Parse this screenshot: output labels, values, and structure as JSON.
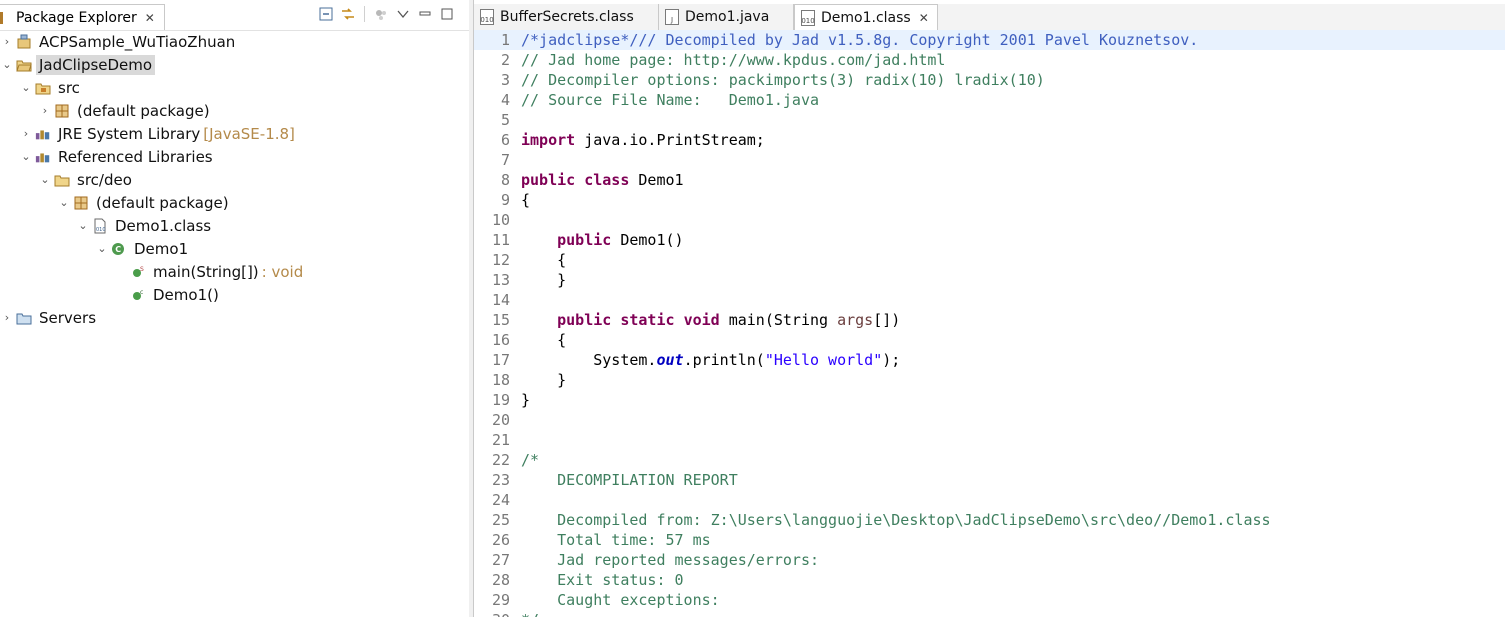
{
  "package_explorer": {
    "title": "Package Explorer",
    "close": "✕",
    "tree": [
      {
        "label": "ACPSample_WuTiaoZhuan",
        "decoration": "",
        "indent": 0,
        "arrow": "›",
        "icon": "project-icon"
      },
      {
        "label": "JadClipseDemo",
        "decoration": "",
        "indent": 0,
        "arrow": "⌄",
        "icon": "project-open-icon",
        "selected": true
      },
      {
        "label": "src",
        "decoration": "",
        "indent": 1,
        "arrow": "⌄",
        "icon": "source-folder-icon"
      },
      {
        "label": "(default package)",
        "decoration": "",
        "indent": 2,
        "arrow": "›",
        "icon": "package-icon"
      },
      {
        "label": "JRE System Library",
        "decoration": "[JavaSE-1.8]",
        "indent": 1,
        "arrow": "›",
        "icon": "library-icon"
      },
      {
        "label": "Referenced Libraries",
        "decoration": "",
        "indent": 1,
        "arrow": "⌄",
        "icon": "library-icon"
      },
      {
        "label": "src/deo",
        "decoration": "",
        "indent": 2,
        "arrow": "⌄",
        "icon": "folder-icon"
      },
      {
        "label": "(default package)",
        "decoration": "",
        "indent": 3,
        "arrow": "⌄",
        "icon": "package-icon"
      },
      {
        "label": "Demo1.class",
        "decoration": "",
        "indent": 4,
        "arrow": "⌄",
        "icon": "class-file-icon"
      },
      {
        "label": "Demo1",
        "decoration": "",
        "indent": 5,
        "arrow": "⌄",
        "icon": "class-icon"
      },
      {
        "label": "main(String[])",
        "decoration": ": void",
        "indent": 6,
        "arrow": "",
        "icon": "method-static-icon"
      },
      {
        "label": "Demo1()",
        "decoration": "",
        "indent": 6,
        "arrow": "",
        "icon": "constructor-icon"
      },
      {
        "label": "Servers",
        "decoration": "",
        "indent": 0,
        "arrow": "›",
        "icon": "servers-folder-icon"
      }
    ]
  },
  "editor": {
    "tabs": [
      {
        "label": "BufferSecrets.class",
        "active": false
      },
      {
        "label": "Demo1.java",
        "active": false
      },
      {
        "label": "Demo1.class",
        "active": true
      }
    ],
    "close": "✕",
    "lines": [
      [
        {
          "t": "/*jadclipse*/// Decompiled by Jad v1.5.8g. Copyright 2001 Pavel Kouznetsov.",
          "c": "jd"
        }
      ],
      [
        {
          "t": "// Jad home page: http://www.kpdus.com/jad.html",
          "c": "c"
        }
      ],
      [
        {
          "t": "// Decompiler options: packimports(3) radix(10) lradix(10) ",
          "c": "c"
        }
      ],
      [
        {
          "t": "// Source File Name:   Demo1.java",
          "c": "c"
        }
      ],
      [],
      [
        {
          "t": "import",
          "c": "kw"
        },
        {
          "t": " java.io.PrintStream;",
          "c": "txt"
        }
      ],
      [],
      [
        {
          "t": "public",
          "c": "kw"
        },
        {
          "t": " ",
          "c": "txt"
        },
        {
          "t": "class",
          "c": "kw"
        },
        {
          "t": " Demo1",
          "c": "txt"
        }
      ],
      [
        {
          "t": "{",
          "c": "txt"
        }
      ],
      [],
      [
        {
          "t": "    ",
          "c": "txt"
        },
        {
          "t": "public",
          "c": "kw"
        },
        {
          "t": " Demo1()",
          "c": "txt"
        }
      ],
      [
        {
          "t": "    {",
          "c": "txt"
        }
      ],
      [
        {
          "t": "    }",
          "c": "txt"
        }
      ],
      [],
      [
        {
          "t": "    ",
          "c": "txt"
        },
        {
          "t": "public",
          "c": "kw"
        },
        {
          "t": " ",
          "c": "txt"
        },
        {
          "t": "static",
          "c": "kw"
        },
        {
          "t": " ",
          "c": "txt"
        },
        {
          "t": "void",
          "c": "kw"
        },
        {
          "t": " main(String ",
          "c": "txt"
        },
        {
          "t": "args",
          "c": "var"
        },
        {
          "t": "[])",
          "c": "txt"
        }
      ],
      [
        {
          "t": "    {",
          "c": "txt"
        }
      ],
      [
        {
          "t": "        System.",
          "c": "txt"
        },
        {
          "t": "out",
          "c": "fld"
        },
        {
          "t": ".println(",
          "c": "txt"
        },
        {
          "t": "\"Hello world\"",
          "c": "str"
        },
        {
          "t": ");",
          "c": "txt"
        }
      ],
      [
        {
          "t": "    }",
          "c": "txt"
        }
      ],
      [
        {
          "t": "}",
          "c": "txt"
        }
      ],
      [],
      [],
      [
        {
          "t": "/*",
          "c": "c"
        }
      ],
      [
        {
          "t": "    DECOMPILATION REPORT",
          "c": "c"
        }
      ],
      [],
      [
        {
          "t": "    Decompiled from: Z:\\Users\\langguojie\\Desktop\\JadClipseDemo\\src\\deo//Demo1.class",
          "c": "c"
        }
      ],
      [
        {
          "t": "    Total time: 57 ms",
          "c": "c"
        }
      ],
      [
        {
          "t": "    Jad reported messages/errors:",
          "c": "c"
        }
      ],
      [
        {
          "t": "    Exit status: 0",
          "c": "c"
        }
      ],
      [
        {
          "t": "    Caught exceptions:",
          "c": "c"
        }
      ],
      [
        {
          "t": "*/",
          "c": "c"
        }
      ]
    ]
  },
  "colors": {
    "comment": "#3f7f5f",
    "keyword": "#7f0055",
    "string": "#2a00ff",
    "current_line": "#e8f2fe"
  }
}
